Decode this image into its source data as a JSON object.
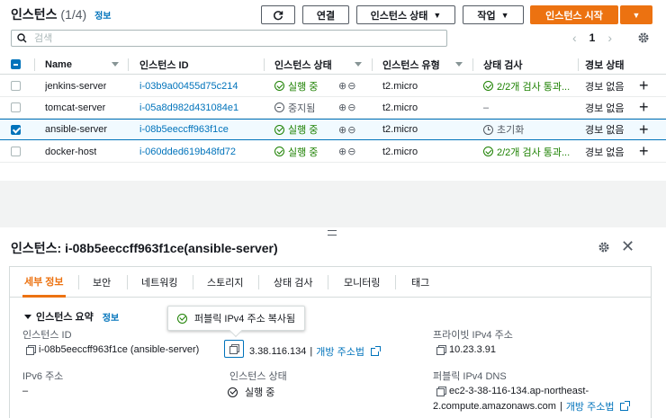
{
  "header": {
    "title": "인스턴스",
    "count": "(1/4)",
    "info": "정보",
    "connect": "연결",
    "instance_state": "인스턴스 상태",
    "actions": "작업",
    "launch": "인스턴스 시작"
  },
  "search": {
    "placeholder": "검색"
  },
  "pager": {
    "page": "1"
  },
  "columns": {
    "name": "Name",
    "instance_id": "인스턴스 ID",
    "state": "인스턴스 상태",
    "type": "인스턴스 유형",
    "status_check": "상태 검사",
    "alarm": "경보 상태"
  },
  "rows": [
    {
      "name": "jenkins-server",
      "id": "i-03b9a00455d75c214",
      "state": "실행 중",
      "type": "t2.micro",
      "check": "2/2개 검사 통과...",
      "alarm": "경보 없음"
    },
    {
      "name": "tomcat-server",
      "id": "i-05a8d982d431084e1",
      "state": "중지됨",
      "type": "t2.micro",
      "check": "–",
      "alarm": "경보 없음"
    },
    {
      "name": "ansible-server",
      "id": "i-08b5eeccff963f1ce",
      "state": "실행 중",
      "type": "t2.micro",
      "check": "초기화",
      "alarm": "경보 없음"
    },
    {
      "name": "docker-host",
      "id": "i-060dded619b48fd72",
      "state": "실행 중",
      "type": "t2.micro",
      "check": "2/2개 검사 통과...",
      "alarm": "경보 없음"
    }
  ],
  "detail": {
    "title": "인스턴스: i-08b5eeccff963f1ce(ansible-server)",
    "tabs": [
      "세부 정보",
      "보안",
      "네트워킹",
      "스토리지",
      "상태 검사",
      "모니터링",
      "태그"
    ],
    "section": "인스턴스 요약",
    "section_info": "정보",
    "instance_id_label": "인스턴스 ID",
    "instance_id_value": "i-08b5eeccff963f1ce (ansible-server)",
    "public_ip_value": "3.38.116.134",
    "open_address": "개방 주소법",
    "private_ip_label": "프라이빗 IPv4 주소",
    "private_ip_value": "10.23.3.91",
    "ipv6_label": "IPv6 주소",
    "ipv6_value": "–",
    "state_label": "인스턴스 상태",
    "state_value": "실행 중",
    "public_dns_label": "퍼블릭 IPv4 DNS",
    "public_dns_line1": "ec2-3-38-116-134.ap-northeast-",
    "public_dns_line2": "2.compute.amazonaws.com",
    "open_address_2": "개방 주소법"
  },
  "tooltip": {
    "text": "퍼블릭 IPv4 주소 복사됨"
  },
  "colors": {
    "accent": "#ec7211",
    "link": "#0073bb",
    "success": "#1d8102"
  }
}
